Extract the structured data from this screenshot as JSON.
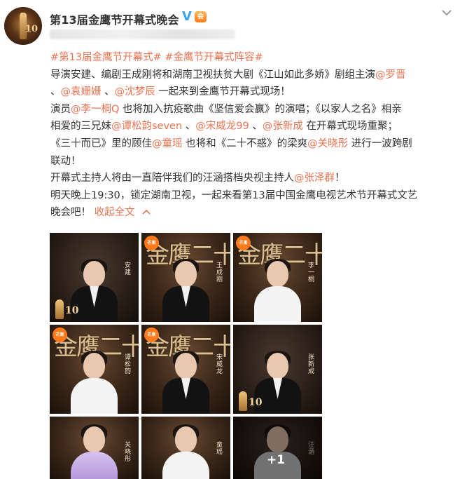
{
  "post": {
    "username": "第13届金鹰节开幕式晚会",
    "verified_badge": "V",
    "level_badge": "会",
    "menu_icon": "chevron-down-icon"
  },
  "content": {
    "line1_tags": [
      "#第13届金鹰节开幕式#",
      "#金鹰节开幕式阵容#"
    ],
    "line2_text": "导演安建、编剧王成刚将和湖南卫视扶贫大剧《江山如此多娇》剧组主演",
    "line2_mention": "@罗晋",
    "line3_sep1": "、",
    "line3_mention1": "@袁姗姗",
    "line3_sep2": " 、",
    "line3_mention2": "@沈梦辰",
    "line3_text": " 一起来到金鹰节开幕式现场！",
    "line4_text1": "演员",
    "line4_mention": "@李一桐Q",
    "line4_text2": " 也将加入抗疫歌曲《坚信爱会赢》的演唱；《以家人之名》相亲",
    "line5_text1": "相爱的三兄妹",
    "line5_mention1": "@谭松韵seven",
    "line5_sep1": " 、",
    "line5_mention2": "@宋威龙99",
    "line5_sep2": " 、",
    "line5_mention3": "@张新成",
    "line5_text2": " 在开幕式现场重聚；",
    "line6_text1": "《三十而已》里的顾佳",
    "line6_mention1": "@童瑶",
    "line6_text2": " 也将和《二十不惑》的梁爽",
    "line6_mention2": "@关晓彤",
    "line6_text3": " 进行一波跨剧",
    "line7_text": "联动！",
    "line8_text": "开幕式主持人将由一直陪伴我们的汪涵搭档央视主持人",
    "line8_mention": "@张泽群",
    "line8_end": "！",
    "line9_text": "明天晚上19:30，锁定湖南卫视，一起来看第13届中国金鹰电视艺术节开幕式文艺",
    "line10_text": "晚会吧！",
    "fold_label": "收起全文",
    "fold_icon": "chevron-up-icon"
  },
  "images": {
    "tile_title": "金鹰二十一湖",
    "logo_label": "芒果",
    "badge_number": "10",
    "names": [
      "安建",
      "王成刚",
      "李一桐",
      "谭松韵",
      "宋威龙",
      "张新成",
      "关晓彤",
      "童瑶",
      "汪涵"
    ],
    "more_count": "+1"
  }
}
